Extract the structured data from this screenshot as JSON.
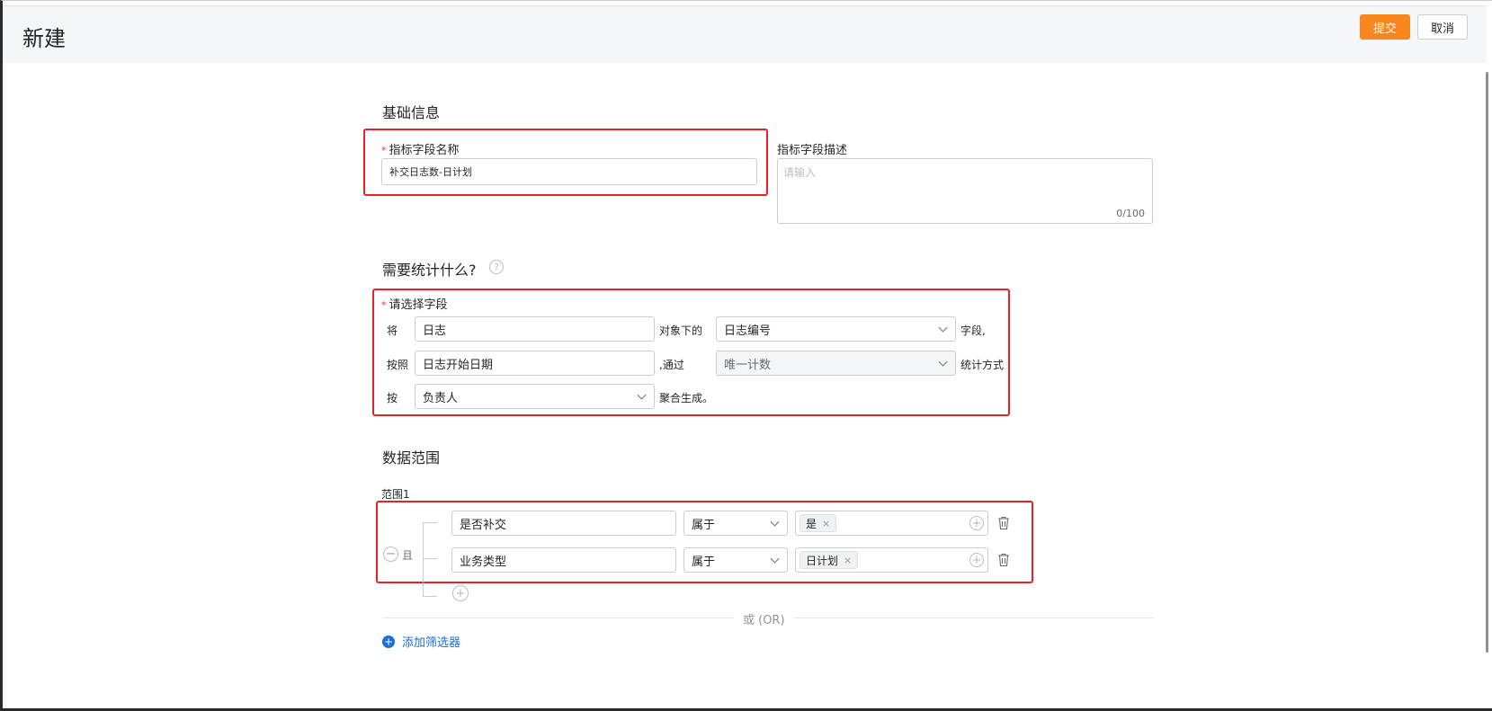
{
  "header": {
    "title": "新建",
    "submit_label": "提交",
    "cancel_label": "取消"
  },
  "basic_info": {
    "section_title": "基础信息",
    "name_label": "指标字段名称",
    "name_value": "补交日志数-日计划",
    "desc_label": "指标字段描述",
    "desc_placeholder": "请输入",
    "desc_counter": "0/100"
  },
  "stats": {
    "section_title": "需要统计什么?",
    "field_label": "请选择字段",
    "row1": {
      "prefix": "将",
      "object_value": "日志",
      "middle": "对象下的",
      "field_value": "日志编号",
      "suffix": "字段,"
    },
    "row2": {
      "prefix": "按照",
      "date_value": "日志开始日期",
      "middle": ",通过",
      "method_value": "唯一计数",
      "suffix": "统计方式"
    },
    "row3": {
      "prefix": "按",
      "group_value": "负责人",
      "suffix": "聚合生成。"
    }
  },
  "data_range": {
    "section_title": "数据范围",
    "range_label": "范围1",
    "logic_label": "且",
    "conditions": [
      {
        "field": "是否补交",
        "operator": "属于",
        "tag": "是"
      },
      {
        "field": "业务类型",
        "operator": "属于",
        "tag": "日计划"
      }
    ],
    "or_label": "或 (OR)",
    "add_filter_label": "添加筛选器"
  }
}
